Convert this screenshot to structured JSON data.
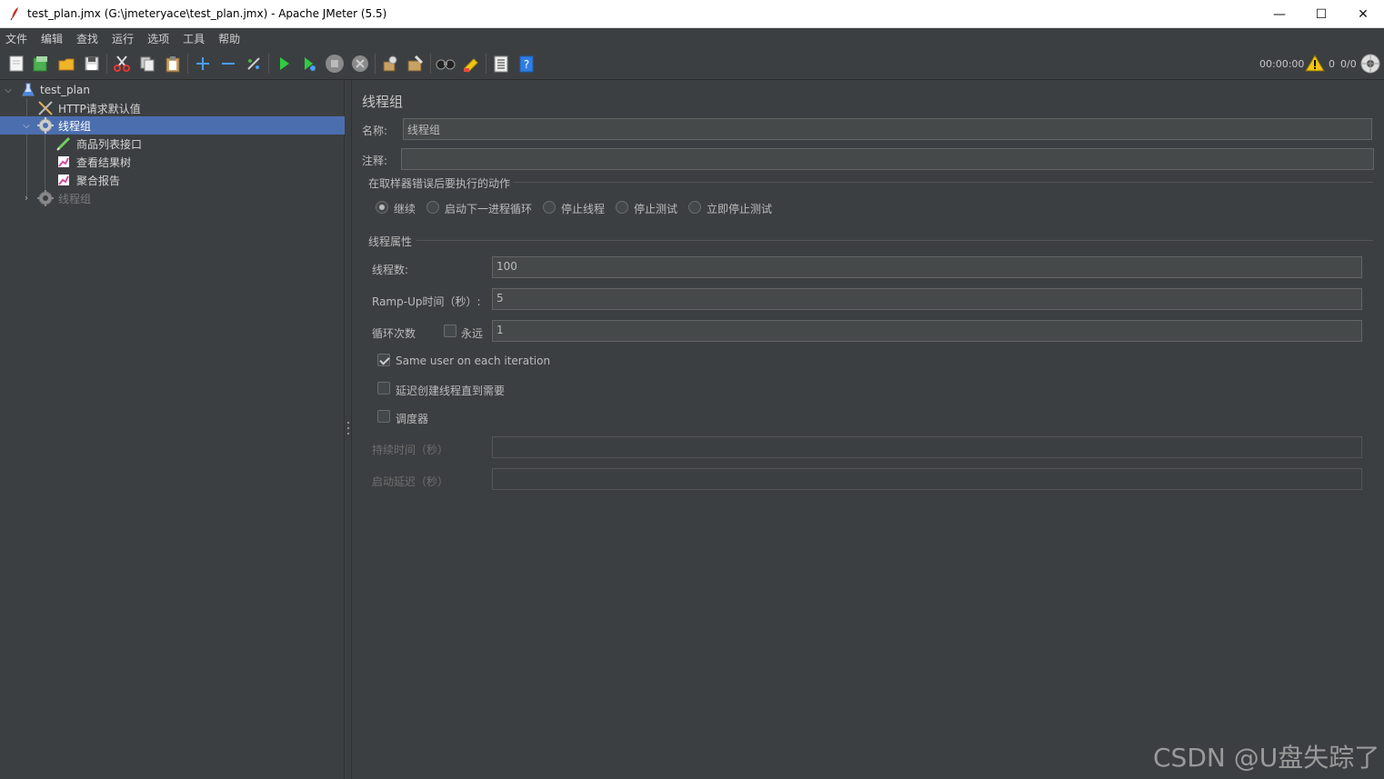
{
  "window": {
    "title": "test_plan.jmx (G:\\jmeteryace\\test_plan.jmx) - Apache JMeter (5.5)",
    "minimize_glyph": "—",
    "maximize_glyph": "☐",
    "close_glyph": "✕"
  },
  "menu": [
    "文件",
    "编辑",
    "查找",
    "运行",
    "选项",
    "工具",
    "帮助"
  ],
  "toolbar": {
    "icons": [
      "new-icon",
      "templates-icon",
      "open-icon",
      "save-icon",
      "cut-icon",
      "copy-icon",
      "paste-icon",
      "expand-icon",
      "collapse-icon",
      "toggle-icon",
      "start-icon",
      "start-no-pause-icon",
      "stop-icon",
      "shutdown-icon",
      "clear-icon",
      "clear-all-icon",
      "search-icon",
      "reset-search-icon",
      "function-helper-icon",
      "help-icon"
    ],
    "elapsed_time": "00:00:00",
    "error_count": "0",
    "thread_count": "0/0"
  },
  "tree": {
    "items": [
      {
        "label": "test_plan",
        "icon": "test-plan-icon",
        "expanded": true
      },
      {
        "label": "HTTP请求默认值",
        "icon": "config-element-icon"
      },
      {
        "label": "线程组",
        "icon": "thread-group-icon",
        "expanded": true,
        "selected": true
      },
      {
        "label": "商品列表接口",
        "icon": "http-sampler-icon"
      },
      {
        "label": "查看结果树",
        "icon": "listener-icon"
      },
      {
        "label": "聚合报告",
        "icon": "listener-icon"
      },
      {
        "label": "线程组",
        "icon": "thread-group-icon",
        "expanded": false,
        "disabled": true
      }
    ]
  },
  "editor": {
    "heading": "线程组",
    "name_label": "名称:",
    "name_value": "线程组",
    "comment_label": "注释:",
    "comment_value": "",
    "error_action": {
      "title": "在取样器错误后要执行的动作",
      "options": [
        "继续",
        "启动下一进程循环",
        "停止线程",
        "停止测试",
        "立即停止测试"
      ],
      "selected": "继续"
    },
    "thread_props": {
      "title": "线程属性",
      "threads_label": "线程数:",
      "threads_value": "100",
      "rampup_label": "Ramp-Up时间（秒）:",
      "rampup_value": "5",
      "loop_label": "循环次数",
      "forever_label": "永远",
      "forever_checked": false,
      "loop_value": "1",
      "same_user_label": "Same user on each iteration",
      "same_user_checked": true,
      "delay_label": "延迟创建线程直到需要",
      "delay_checked": false,
      "scheduler_label": "调度器",
      "scheduler_checked": false,
      "duration_label": "持续时间（秒）",
      "duration_value": "",
      "startup_delay_label": "启动延迟（秒）",
      "startup_delay_value": ""
    }
  },
  "watermark": "CSDN @U盘失踪了",
  "colors": {
    "background": "#3c3f41",
    "selection": "#4b6eaf",
    "field": "#45494a",
    "text": "#bbbbbb"
  }
}
